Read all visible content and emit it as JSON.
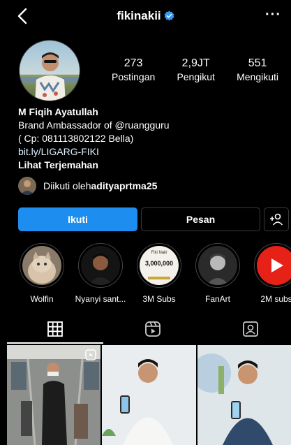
{
  "header": {
    "username": "fikinakii",
    "verified_icon": "verified-badge-icon",
    "back_icon": "back-arrow-icon",
    "more_icon": "more-options-icon",
    "more_label": "···"
  },
  "stats": [
    {
      "value": "273",
      "label": "Postingan"
    },
    {
      "value": "2,9JT",
      "label": "Pengikut"
    },
    {
      "value": "551",
      "label": "Mengikuti"
    }
  ],
  "bio": {
    "name": "M Fiqih Ayatullah",
    "line1": "Brand Ambassador of @ruangguru",
    "line2": "( Cp:  081113802122 Bella)",
    "link": "bit.ly/LIGARG-FIKI",
    "translate": "Lihat Terjemahan"
  },
  "followed_by": {
    "prefix": "Diikuti oleh ",
    "user": "adityaprtma25"
  },
  "actions": {
    "follow": "Ikuti",
    "message": "Pesan",
    "add_icon": "add-person-icon"
  },
  "highlights": [
    {
      "label": "Wolfin"
    },
    {
      "label": "Nyanyi sant..."
    },
    {
      "label": "3M Subs",
      "inner_top": "Fiki Naki",
      "inner_count": "3,000,000"
    },
    {
      "label": "FanArt"
    },
    {
      "label": "2M subs"
    }
  ],
  "tabs": [
    "grid-icon",
    "reels-icon",
    "tagged-icon"
  ],
  "colors": {
    "accent": "#1d8ef0",
    "background": "#000000",
    "youtube_red": "#e62117"
  }
}
